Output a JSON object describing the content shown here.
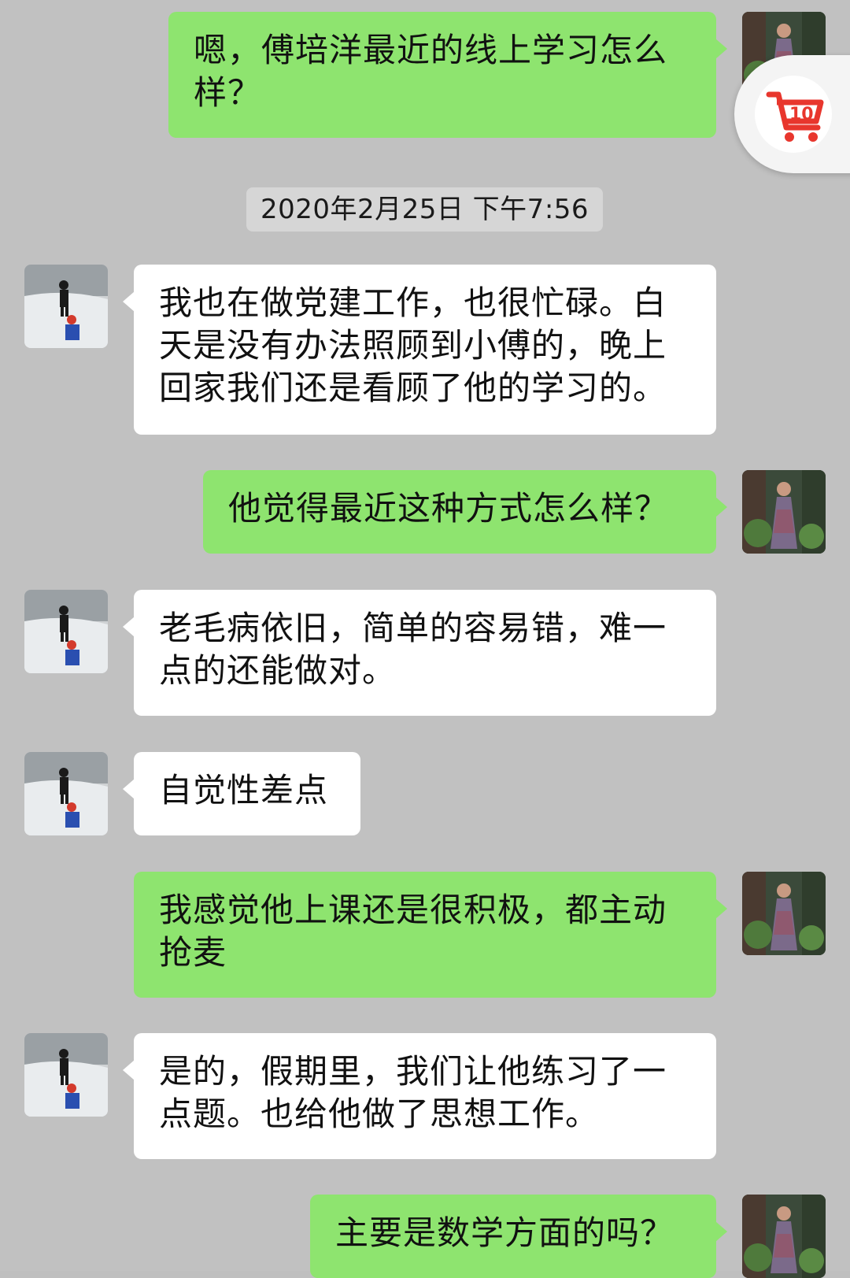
{
  "timestamp": "2020年2月25日 下午7:56",
  "messages": [
    {
      "side": "out",
      "text": "嗯，傅培洋最近的线上学习怎么样？"
    },
    {
      "side": "in",
      "text": "我也在做党建工作，也很忙碌。白天是没有办法照顾到小傅的，晚上回家我们还是看顾了他的学习的。"
    },
    {
      "side": "out",
      "text": "他觉得最近这种方式怎么样？"
    },
    {
      "side": "in",
      "text": "老毛病依旧，简单的容易错，难一点的还能做对。"
    },
    {
      "side": "in",
      "text": "自觉性差点"
    },
    {
      "side": "out",
      "text": "我感觉他上课还是很积极，都主动抢麦"
    },
    {
      "side": "in",
      "text": "是的，假期里，我们让他练习了一点题。也给他做了思想工作。"
    },
    {
      "side": "out",
      "text": "主要是数学方面的吗？"
    }
  ],
  "floating_button": {
    "icon": "cart-return-icon",
    "accent_color": "#e8362d"
  },
  "colors": {
    "background": "#c1c1c1",
    "outgoing_bubble": "#8ee46f",
    "incoming_bubble": "#ffffff"
  }
}
